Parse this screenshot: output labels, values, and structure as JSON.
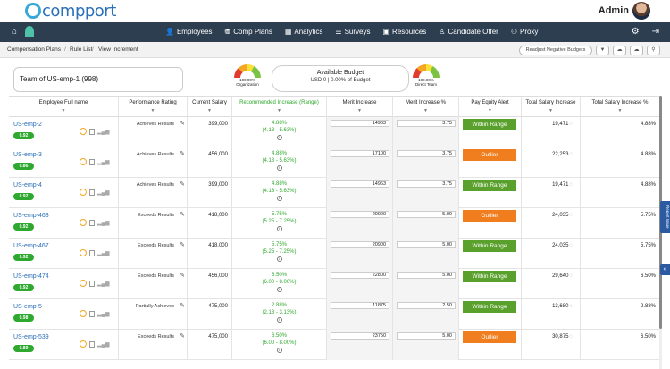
{
  "app": {
    "logo_text": "compport",
    "user_name": "Admin"
  },
  "nav": {
    "items": [
      {
        "icon": "person-icon",
        "glyph": "👤",
        "label": "Employees"
      },
      {
        "icon": "coins-icon",
        "glyph": "⛃",
        "label": "Comp Plans"
      },
      {
        "icon": "analytics-icon",
        "glyph": "▦",
        "label": "Analytics"
      },
      {
        "icon": "list-icon",
        "glyph": "☰",
        "label": "Surveys"
      },
      {
        "icon": "book-icon",
        "glyph": "▣",
        "label": "Resources"
      },
      {
        "icon": "candidate-icon",
        "glyph": "♙",
        "label": "Candidate Offer"
      },
      {
        "icon": "proxy-icon",
        "glyph": "⚇",
        "label": "Proxy"
      }
    ]
  },
  "breadcrumb": {
    "items": [
      "Compensation Plans",
      "Rule List",
      "View Increment"
    ]
  },
  "toolbar": {
    "readjust_label": "Readjust Negative Budgets"
  },
  "summary": {
    "team_label": "Team of US-emp-1 (998)",
    "gauge_org": {
      "pct": "100.00%",
      "label": "Organization"
    },
    "budget_title": "Available Budget",
    "budget_value": "USD 0 | 0.00% of Budget",
    "gauge_direct": {
      "pct": "100.00%",
      "label": "Direct Team"
    }
  },
  "columns": {
    "name": "Employee Full name",
    "perf": "Performance Rating",
    "salary": "Current Salary",
    "rec": "Recommended Increase (Range)",
    "merit": "Merit Increase",
    "merit_pct": "Merit Increase %",
    "equity": "Pay Equity Alert",
    "total": "Total Salary Increase",
    "total_pct": "Total Salary Increase %"
  },
  "rows": [
    {
      "name": "US-emp-2",
      "score": "0.92",
      "perf": "Achieves Results",
      "salary": "399,000",
      "rec": "4.88%",
      "range": "(4.13 - 5.63%)",
      "merit": "14963",
      "merit_pct": "3.75",
      "equity": "Within Range",
      "equity_type": "within",
      "total": "19,471",
      "total_pct": "4.88%"
    },
    {
      "name": "US-emp-3",
      "score": "0.86",
      "perf": "Achieves Results",
      "salary": "456,000",
      "rec": "4.88%",
      "range": "(4.13 - 5.63%)",
      "merit": "17100",
      "merit_pct": "3.75",
      "equity": "Outlier",
      "equity_type": "out",
      "total": "22,253",
      "total_pct": "4.88%"
    },
    {
      "name": "US-emp-4",
      "score": "0.92",
      "perf": "Achieves Results",
      "salary": "399,000",
      "rec": "4.88%",
      "range": "(4.13 - 5.63%)",
      "merit": "14963",
      "merit_pct": "3.75",
      "equity": "Within Range",
      "equity_type": "within",
      "total": "19,471",
      "total_pct": "4.88%"
    },
    {
      "name": "US-emp-463",
      "score": "0.92",
      "perf": "Exceeds Results",
      "salary": "418,000",
      "rec": "5.75%",
      "range": "(5.25 - 7.25%)",
      "merit": "20900",
      "merit_pct": "5.00",
      "equity": "Outlier",
      "equity_type": "out",
      "total": "24,035",
      "total_pct": "5.75%"
    },
    {
      "name": "US-emp-467",
      "score": "0.92",
      "perf": "Exceeds Results",
      "salary": "418,000",
      "rec": "5.75%",
      "range": "(5.25 - 7.25%)",
      "merit": "20900",
      "merit_pct": "5.00",
      "equity": "Within Range",
      "equity_type": "within",
      "total": "24,035",
      "total_pct": "5.75%"
    },
    {
      "name": "US-emp-474",
      "score": "0.92",
      "perf": "Exceeds Results",
      "salary": "456,000",
      "rec": "6.50%",
      "range": "(6.00 - 8.00%)",
      "merit": "22800",
      "merit_pct": "5.00",
      "equity": "Within Range",
      "equity_type": "within",
      "total": "29,640",
      "total_pct": "6.50%"
    },
    {
      "name": "US-emp-5",
      "score": "0.98",
      "perf": "Partially Achieves",
      "salary": "475,000",
      "rec": "2.88%",
      "range": "(2.13 - 3.13%)",
      "merit": "11875",
      "merit_pct": "2.50",
      "equity": "Within Range",
      "equity_type": "within",
      "total": "13,680",
      "total_pct": "2.88%"
    },
    {
      "name": "US-emp-539",
      "score": "0.89",
      "perf": "Exceeds Results",
      "salary": "475,000",
      "rec": "6.50%",
      "range": "(6.00 - 8.00%)",
      "merit": "23750",
      "merit_pct": "5.00",
      "equity": "Outlier",
      "equity_type": "out",
      "total": "30,875",
      "total_pct": "6.50%"
    }
  ],
  "side": {
    "report_issue": "Report Issue"
  }
}
